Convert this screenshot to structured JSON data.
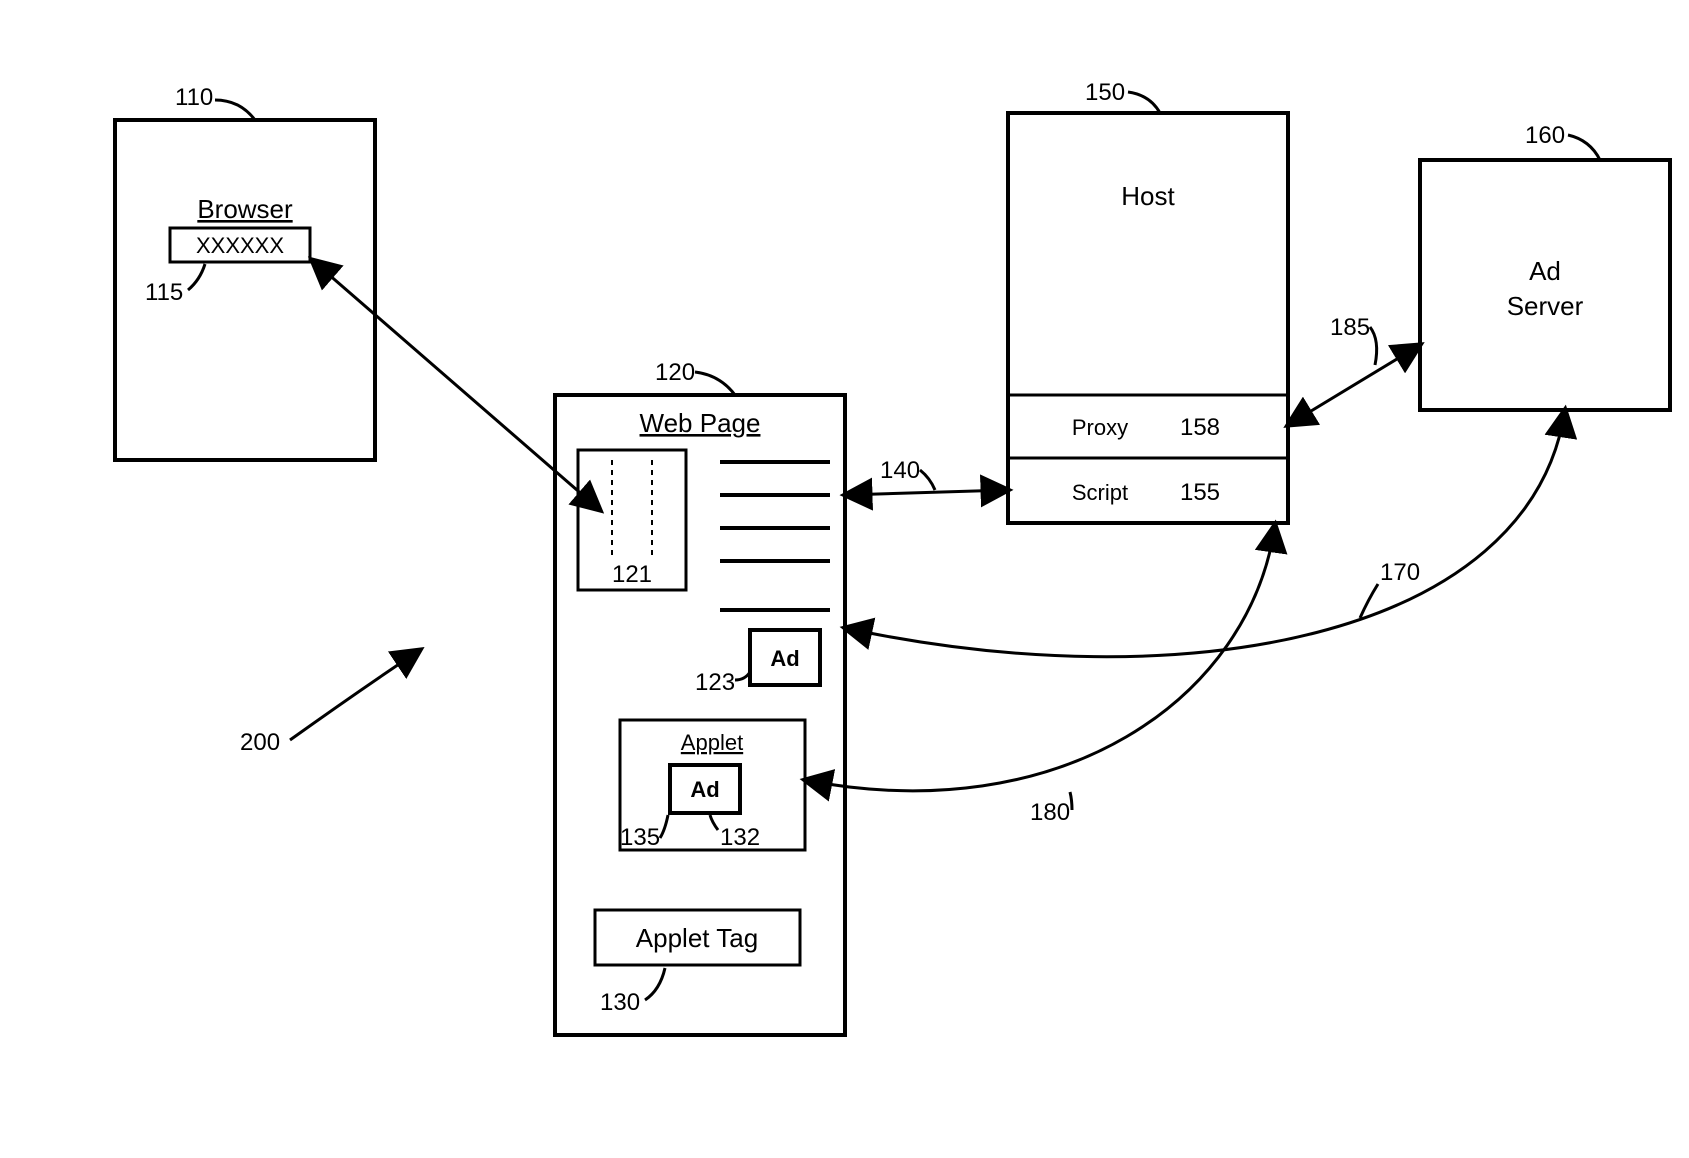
{
  "figure_ref": "200",
  "nodes": {
    "browser": {
      "ref": "110",
      "label": "Browser",
      "link": {
        "ref": "115",
        "text": "XXXXXX"
      }
    },
    "webpage": {
      "ref": "120",
      "label": "Web Page",
      "thumb": {
        "ref": "121"
      },
      "ad": {
        "ref": "123",
        "label": "Ad"
      },
      "applet": {
        "ref": "135",
        "label": "Applet",
        "ad": {
          "ref": "132",
          "label": "Ad"
        }
      },
      "applet_tag": {
        "ref": "130",
        "label": "Applet Tag"
      }
    },
    "host": {
      "ref": "150",
      "label": "Host",
      "proxy": {
        "ref": "158",
        "label": "Proxy"
      },
      "script": {
        "ref": "155",
        "label": "Script"
      }
    },
    "adserver": {
      "ref": "160",
      "label1": "Ad",
      "label2": "Server"
    }
  },
  "edges": {
    "e140": "140",
    "e170": "170",
    "e180": "180",
    "e185": "185"
  }
}
